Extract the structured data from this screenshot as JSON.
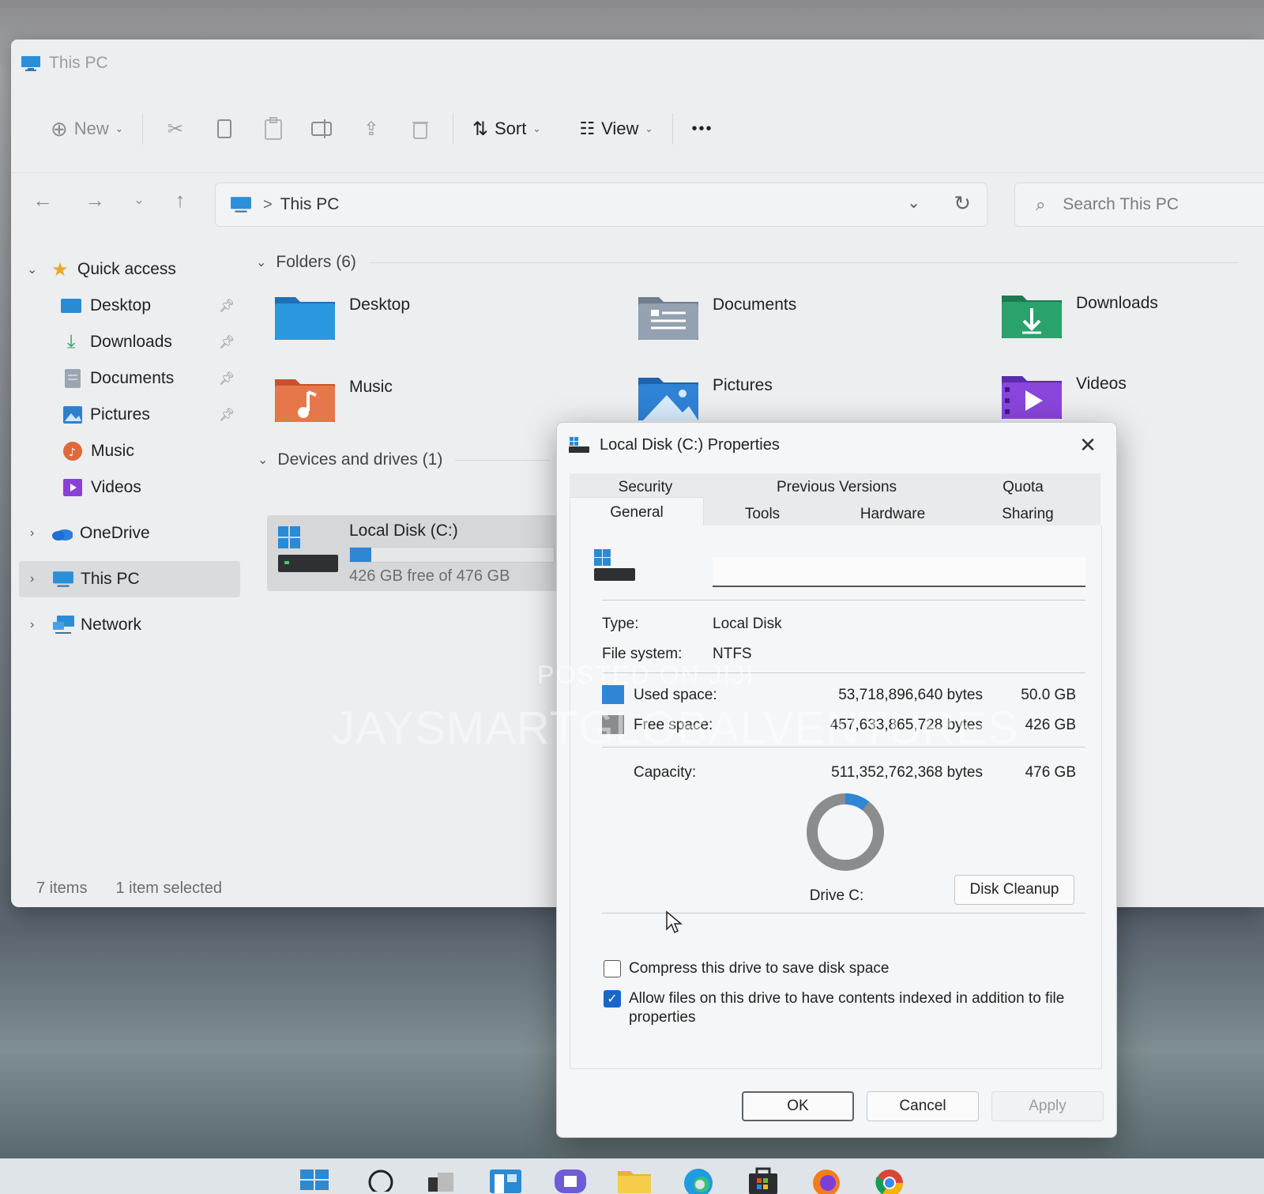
{
  "window": {
    "title": "This PC"
  },
  "toolbar": {
    "new_label": "New",
    "sort_label": "Sort",
    "view_label": "View",
    "more_label": "•••"
  },
  "address": {
    "crumb": "This PC",
    "separator": ">"
  },
  "search": {
    "placeholder": "Search This PC"
  },
  "sidebar": {
    "items": [
      {
        "label": "Quick access"
      },
      {
        "label": "Desktop"
      },
      {
        "label": "Downloads"
      },
      {
        "label": "Documents"
      },
      {
        "label": "Pictures"
      },
      {
        "label": "Music"
      },
      {
        "label": "Videos"
      },
      {
        "label": "OneDrive"
      },
      {
        "label": "This PC"
      },
      {
        "label": "Network"
      }
    ]
  },
  "main": {
    "folders_header": "Folders (6)",
    "folders": [
      {
        "name": "Desktop"
      },
      {
        "name": "Documents"
      },
      {
        "name": "Downloads"
      },
      {
        "name": "Music"
      },
      {
        "name": "Pictures"
      },
      {
        "name": "Videos"
      }
    ],
    "devices_header": "Devices and drives (1)",
    "drive": {
      "name": "Local Disk (C:)",
      "free_text": "426 GB free of 476 GB",
      "used_fraction": 0.105
    }
  },
  "statusbar": {
    "items": "7 items",
    "selected": "1 item selected"
  },
  "dialog": {
    "title": "Local Disk (C:) Properties",
    "close": "✕",
    "tabs_top": [
      "Security",
      "Previous Versions",
      "Quota"
    ],
    "tabs_bottom": [
      "General",
      "Tools",
      "Hardware",
      "Sharing"
    ],
    "type_label": "Type:",
    "type_value": "Local Disk",
    "fs_label": "File system:",
    "fs_value": "NTFS",
    "used_label": "Used space:",
    "used_bytes": "53,718,896,640 bytes",
    "used_gb": "50.0 GB",
    "free_label": "Free space:",
    "free_bytes": "457,633,865,728 bytes",
    "free_gb": "426 GB",
    "capacity_label": "Capacity:",
    "capacity_bytes": "511,352,762,368 bytes",
    "capacity_gb": "476 GB",
    "drive_label": "Drive C:",
    "cleanup_button": "Disk Cleanup",
    "compress_label": "Compress this drive to save disk space",
    "compress_checked": false,
    "index_label_line1": "Allow files on this drive to have contents indexed in addition to file",
    "index_label_line2": "properties",
    "index_checked": true,
    "ok": "OK",
    "cancel": "Cancel",
    "apply": "Apply",
    "used_color": "#2f86d3",
    "free_color": "#8a8c8e"
  },
  "watermark": {
    "line1": "POSTED ON JIJI",
    "line2": "JAYSMARTGLOBALVENTURES"
  }
}
